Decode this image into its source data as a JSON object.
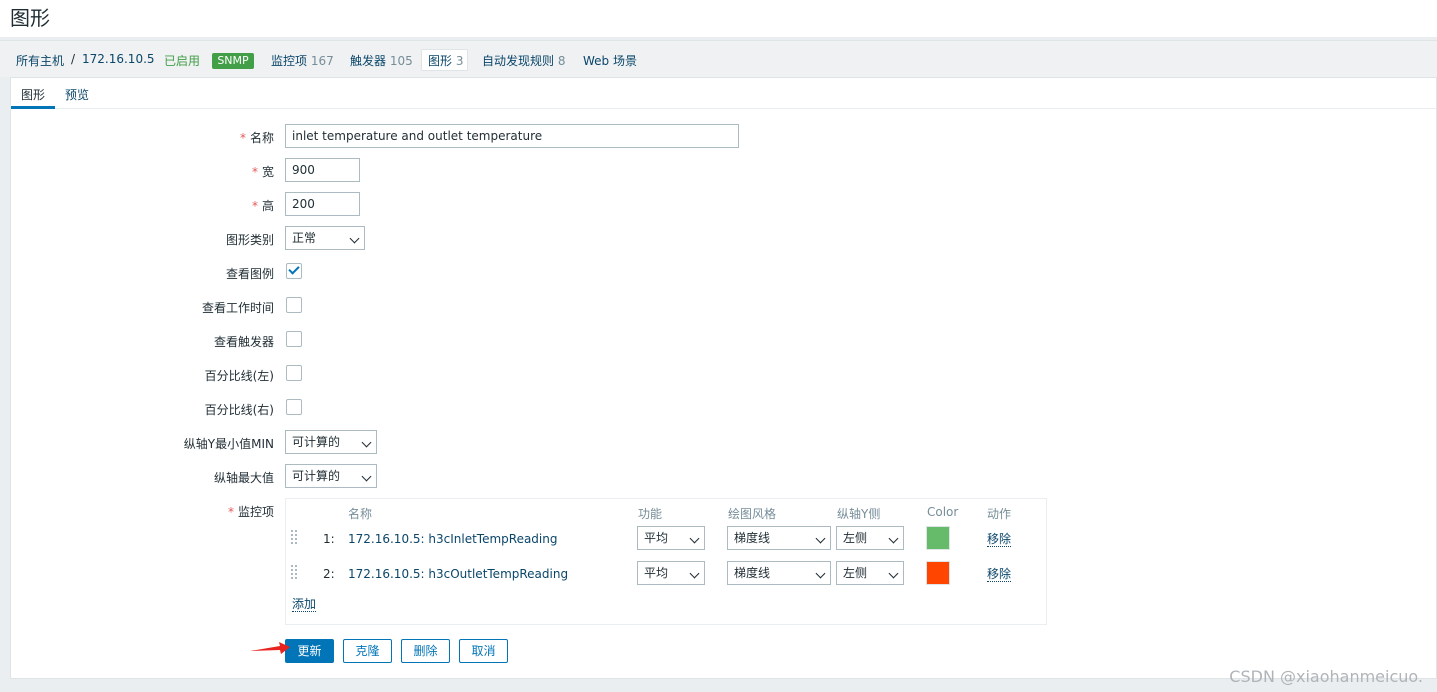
{
  "page": {
    "title": "图形"
  },
  "breadcrumb": {
    "all_hosts": "所有主机",
    "separator": "/",
    "host": "172.16.10.5",
    "status": "已启用",
    "snmp": "SNMP",
    "items": {
      "label": "监控项",
      "count": "167"
    },
    "triggers": {
      "label": "触发器",
      "count": "105"
    },
    "graphs": {
      "label": "图形",
      "count": "3"
    },
    "discovery": {
      "label": "自动发现规则",
      "count": "8"
    },
    "web": "Web 场景"
  },
  "tabs": {
    "graph": "图形",
    "preview": "预览"
  },
  "form": {
    "name_label": "名称",
    "name_value": "inlet temperature  and outlet temperature",
    "width_label": "宽",
    "width_value": "900",
    "height_label": "高",
    "height_value": "200",
    "type_label": "图形类别",
    "type_value": "正常",
    "legend_label": "查看图例",
    "legend_checked": true,
    "worktime_label": "查看工作时间",
    "worktime_checked": false,
    "triggers_label": "查看触发器",
    "triggers_checked": false,
    "percentile_left_label": "百分比线(左)",
    "percentile_left_checked": false,
    "percentile_right_label": "百分比线(右)",
    "percentile_right_checked": false,
    "ymin_label": "纵轴Y最小值MIN",
    "ymin_value": "可计算的",
    "ymax_label": "纵轴最大值",
    "ymax_value": "可计算的",
    "items_label": "监控项",
    "required_mark": "*"
  },
  "items_table": {
    "headers": {
      "name": "名称",
      "function": "功能",
      "draw_style": "绘图风格",
      "y_side": "纵轴Y侧",
      "color": "Color",
      "action": "动作"
    },
    "rows": [
      {
        "num": "1:",
        "name": "172.16.10.5: h3cInletTempReading",
        "function": "平均",
        "draw_style": "梯度线",
        "y_side": "左侧",
        "color": "#66bb6a",
        "action": "移除"
      },
      {
        "num": "2:",
        "name": "172.16.10.5: h3cOutletTempReading",
        "function": "平均",
        "draw_style": "梯度线",
        "y_side": "左侧",
        "color": "#ff4500",
        "action": "移除"
      }
    ],
    "add": "添加"
  },
  "buttons": {
    "update": "更新",
    "clone": "克隆",
    "delete": "删除",
    "cancel": "取消"
  },
  "watermark": "CSDN @xiaohanmeicuo."
}
